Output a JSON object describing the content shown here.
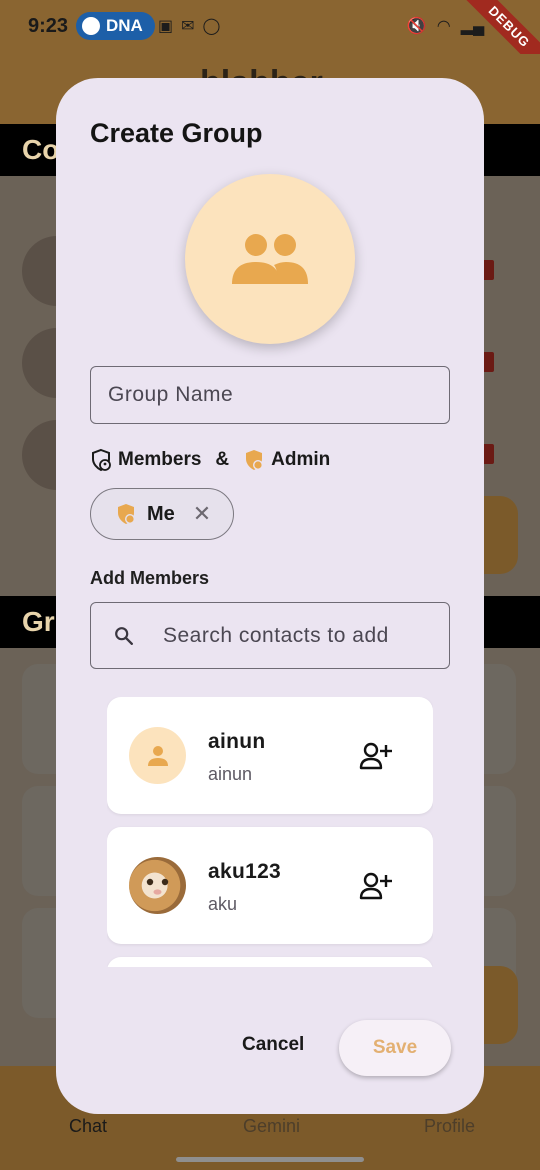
{
  "status_bar": {
    "time": "9:23",
    "spotify_badge": "DNA",
    "debug_label": "DEBUG"
  },
  "app": {
    "title": "blabber",
    "contacts_header": "Co",
    "groups_header": "Gr",
    "nav": {
      "chat": "Chat",
      "gemini": "Gemini",
      "profile": "Profile"
    }
  },
  "dialog": {
    "title": "Create Group",
    "group_name_placeholder": "Group Name",
    "roles": {
      "members": "Members",
      "ampersand": "&",
      "admin": "Admin"
    },
    "selected_chip": {
      "label": "Me",
      "close": "✕"
    },
    "add_members_label": "Add Members",
    "search_placeholder": "Search contacts to add",
    "contacts": [
      {
        "name": "ainun",
        "username": "ainun"
      },
      {
        "name": "aku123",
        "username": "aku"
      }
    ],
    "actions": {
      "cancel": "Cancel",
      "save": "Save"
    }
  },
  "colors": {
    "dialog_bg": "#ebe4f1",
    "accent": "#e8a84f",
    "avatar_bg": "#fce3bd",
    "save_text": "#e3b072"
  }
}
